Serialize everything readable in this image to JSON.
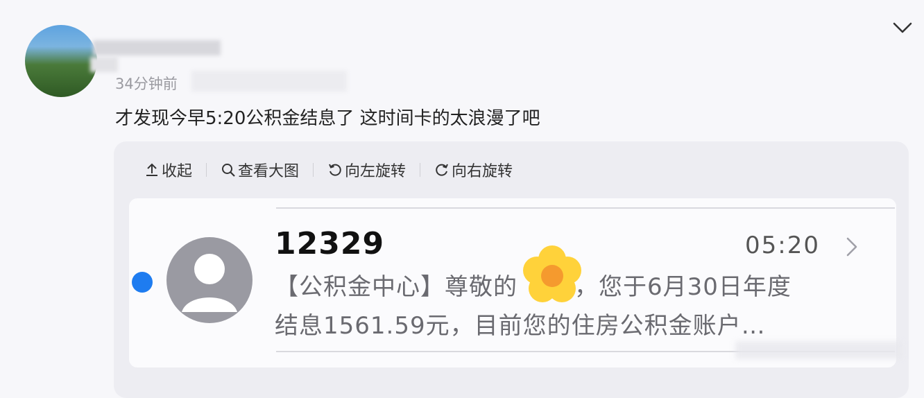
{
  "post": {
    "time_ago": "34分钟前",
    "text": "才发现今早5:20公积金结息了 这时间卡的太浪漫了吧"
  },
  "toolbar": {
    "collapse_label": "收起",
    "view_large_label": "查看大图",
    "rotate_left_label": "向左旋转",
    "rotate_right_label": "向右旋转"
  },
  "sms": {
    "sender": "12329",
    "time": "05:20",
    "preview_line1_a": "【公积金中心】尊敬的",
    "preview_line1_b": "，您于6月30日年度",
    "preview_line2": "结息1561.59元，目前您的住房公积金账户…"
  },
  "icons": {
    "collapse_chevron": "chevron-down-icon",
    "collapse": "upload-arrow-icon",
    "view_large": "magnifier-icon",
    "rotate_left": "rotate-left-icon",
    "rotate_right": "rotate-right-icon",
    "sms_chevron": "chevron-right-icon",
    "contact": "person-icon",
    "sticker": "flower-sticker-icon"
  },
  "colors": {
    "unread_dot": "#1e7cf0",
    "sticker_petal": "#ffd23a",
    "sticker_center": "#f59a2e"
  }
}
